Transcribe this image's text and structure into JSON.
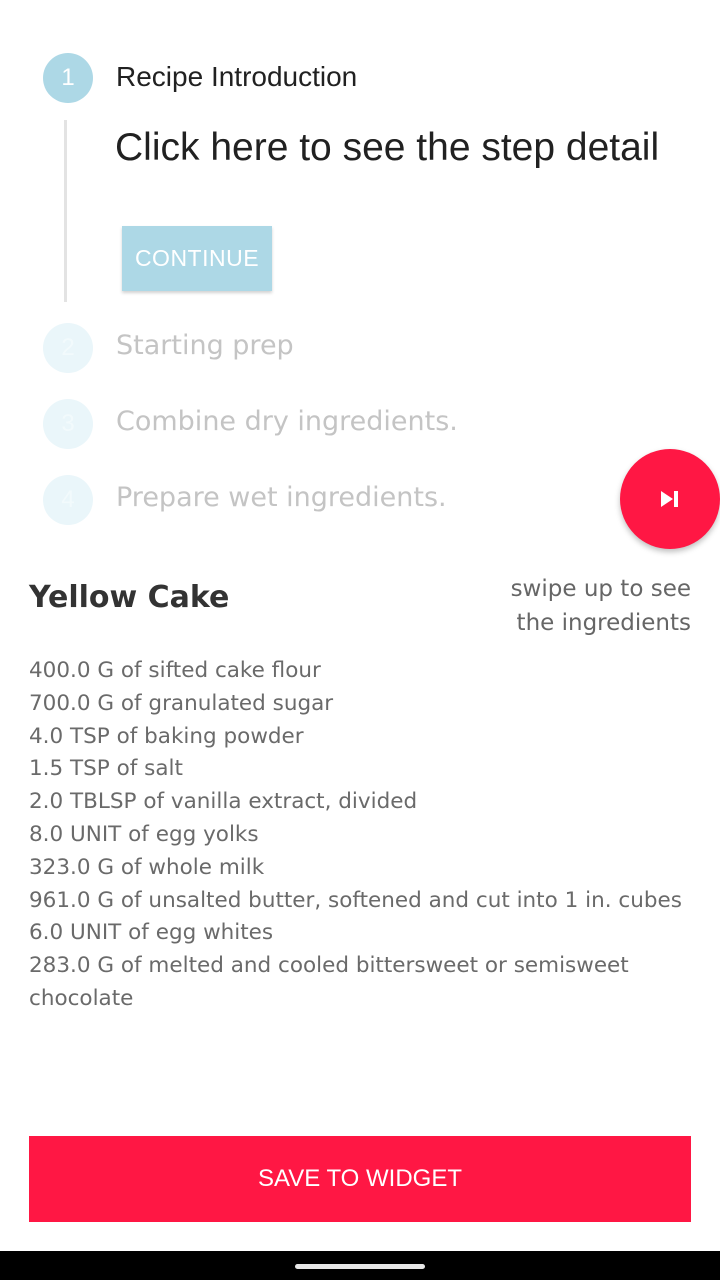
{
  "stepper": {
    "steps": [
      {
        "number": "1",
        "title": "Recipe Introduction",
        "active": true
      },
      {
        "number": "2",
        "title": "Starting prep",
        "active": false
      },
      {
        "number": "3",
        "title": "Combine dry ingredients.",
        "active": false
      },
      {
        "number": "4",
        "title": "Prepare wet ingredients.",
        "active": false
      }
    ],
    "detail": "Click here to see the step detail",
    "continue_label": "CONTINUE"
  },
  "fab": {
    "icon": "skip-next-icon"
  },
  "recipe": {
    "title": "Yellow Cake",
    "swipe_hint_line1": "swipe up to see",
    "swipe_hint_line2": "the ingredients",
    "ingredients": [
      "400.0 G of sifted cake flour",
      "700.0 G of granulated sugar",
      "4.0 TSP of baking powder",
      "1.5 TSP of salt",
      "2.0 TBLSP of vanilla extract, divided",
      "8.0 UNIT of egg yolks",
      "323.0 G of whole milk",
      "961.0 G of unsalted butter, softened and cut into 1 in. cubes",
      "6.0 UNIT of egg whites",
      "283.0 G of melted and cooled bittersweet or semisweet chocolate"
    ]
  },
  "save_label": "SAVE TO WIDGET",
  "colors": {
    "accent": "#ff1744",
    "step_active": "#add8e6"
  }
}
